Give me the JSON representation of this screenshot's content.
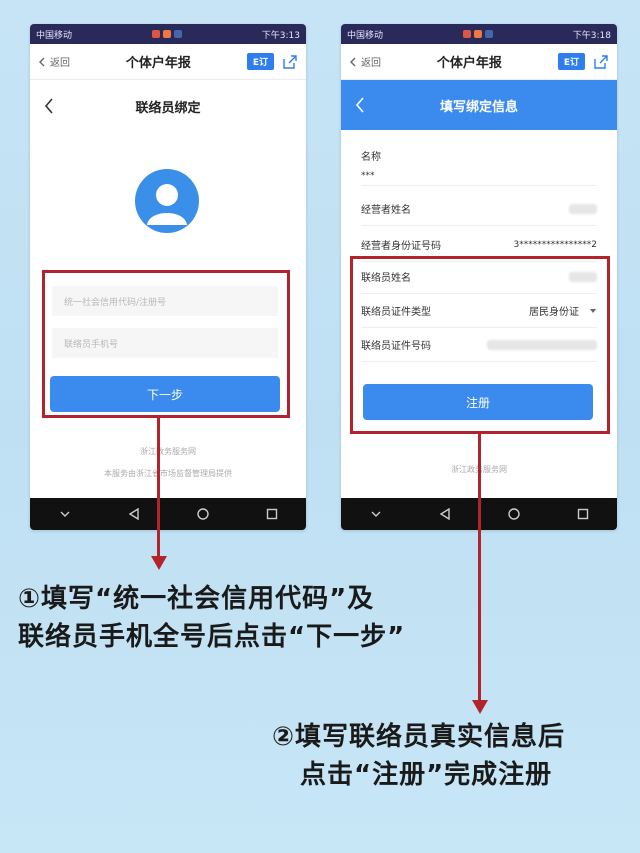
{
  "phone1": {
    "status_left": "中国移动",
    "status_right": "下午3:13",
    "nav_back": "返回",
    "nav_title": "个体户年报",
    "nav_badge": "E订",
    "page_title": "联络员绑定",
    "input_credit_code_placeholder": "统一社会信用代码/注册号",
    "input_phone_placeholder": "联络员手机号",
    "next_button": "下一步",
    "footer_line1": "浙江政务服务网",
    "footer_line2": "本服务由浙江省市场监督管理局提供"
  },
  "phone2": {
    "status_left": "中国移动",
    "status_right": "下午3:18",
    "nav_back": "返回",
    "nav_title": "个体户年报",
    "nav_badge": "E订",
    "page_title": "填写绑定信息",
    "fields": {
      "name_label": "名称",
      "name_value": "***",
      "operator_name_label": "经营者姓名",
      "operator_id_label": "经营者身份证号码",
      "operator_id_value": "3****************2",
      "contact_name_label": "联络员姓名",
      "contact_id_type_label": "联络员证件类型",
      "contact_id_type_value": "居民身份证",
      "contact_id_number_label": "联络员证件号码"
    },
    "register_button": "注册",
    "footer_line1": "浙江政务服务网"
  },
  "captions": {
    "step1_line1": "①填写“统一社会信用代码”及",
    "step1_line2": "联络员手机全号后点击“下一步”",
    "step2_line1": "②填写联络员真实信息后",
    "step2_line2": "点击“注册”完成注册"
  },
  "colors": {
    "accent_blue": "#3b8bef",
    "highlight_red": "#b3232b",
    "background": "#c6e4f5"
  }
}
